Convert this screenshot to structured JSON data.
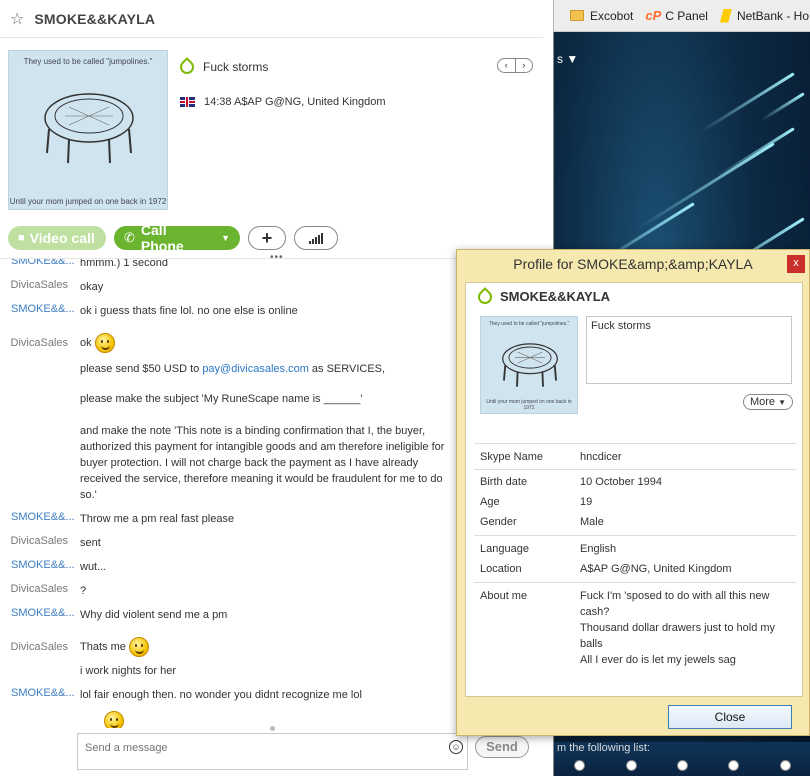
{
  "chat": {
    "contact_name": "SMOKE&&KAYLA",
    "mood": "Fuck storms",
    "location": "14:38 A$AP G@NG, United Kingdom",
    "avatar_caption_top": "They used to be called \"jumpolines.\"",
    "avatar_caption_bottom": "Until your mom jumped on one back in 1972",
    "buttons": {
      "video_call": "Video call",
      "call_phone": "Call Phone"
    },
    "compose_placeholder": "Send a message",
    "send_label": "Send",
    "messages": [
      {
        "sender": "SMOKE&&...",
        "type": "smoke",
        "text": "hmmm.) 1 second"
      },
      {
        "sender": "DivicaSales",
        "type": "divica",
        "text": "okay"
      },
      {
        "sender": "SMOKE&&...",
        "type": "smoke",
        "text": "ok i guess thats fine lol. no one else is online"
      },
      {
        "sender": "DivicaSales",
        "type": "divica",
        "text": "ok"
      },
      {
        "sender": "",
        "type": "divica",
        "text_before": "please send $50 USD to ",
        "link": "pay@divicasales.com",
        "text_after": " as SERVICES,"
      },
      {
        "sender": "",
        "type": "divica",
        "text": "please make the subject 'My RuneScape name is ______'"
      },
      {
        "sender": "",
        "type": "divica",
        "text": "and make the note 'This note is a binding confirmation that I, the buyer, authorized this payment for intangible goods and am therefore ineligible for buyer protection. I will not charge back the payment as I have already received the service, therefore meaning it would be fraudulent for me to do so.'"
      },
      {
        "sender": "SMOKE&&...",
        "type": "smoke",
        "text": "Throw me a pm real fast please"
      },
      {
        "sender": "DivicaSales",
        "type": "divica",
        "text": "sent"
      },
      {
        "sender": "SMOKE&&...",
        "type": "smoke",
        "text": "wut..."
      },
      {
        "sender": "DivicaSales",
        "type": "divica",
        "text": "?"
      },
      {
        "sender": "SMOKE&&...",
        "type": "smoke",
        "text": "Why did violent send me a pm"
      },
      {
        "sender": "DivicaSales",
        "type": "divica",
        "text": "Thats me"
      },
      {
        "sender": "",
        "type": "divica",
        "text": "i work nights for her"
      },
      {
        "sender": "SMOKE&&...",
        "type": "smoke",
        "text": "lol fair enough then. no wonder you didnt recognize me lol"
      }
    ]
  },
  "browser": {
    "bookmarks": [
      "Excobot",
      "C Panel",
      "NetBank - Ho"
    ],
    "background_label": "s ▼",
    "bottom_text": "m the following list:"
  },
  "profile": {
    "title": "Profile for SMOKE&amp;&amp;KAYLA",
    "name": "SMOKE&&KAYLA",
    "mood": "Fuck storms",
    "more_label": "More",
    "close_label": "Close",
    "close_x": "x",
    "fields": {
      "skype_name": {
        "label": "Skype Name",
        "value": "hncdicer"
      },
      "birth_date": {
        "label": "Birth date",
        "value": "10 October 1994"
      },
      "age": {
        "label": "Age",
        "value": "19"
      },
      "gender": {
        "label": "Gender",
        "value": "Male"
      },
      "language": {
        "label": "Language",
        "value": "English"
      },
      "location": {
        "label": "Location",
        "value": "A$AP G@NG, United Kingdom"
      },
      "about": {
        "label": "About me",
        "value": "Fuck I'm 'sposed to do with all this new cash?\nThousand dollar drawers just to hold my balls\nAll I ever do is let my jewels sag"
      }
    }
  }
}
